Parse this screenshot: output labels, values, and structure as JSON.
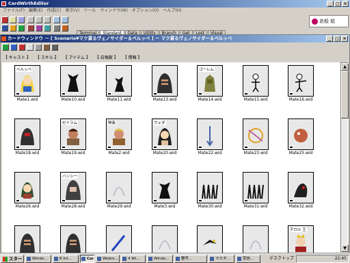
{
  "app": {
    "title": "CardWirthEditor",
    "menu": [
      "ファイル(F)",
      "編集(E)",
      "作成(C)",
      "表示(V)",
      "ツール",
      "ウィンドウ(W)",
      "オプション(O)",
      "ヘルプ(H)"
    ]
  },
  "palette": {
    "tabs": [
      "Terminal",
      "Standard",
      "Data",
      "Utility",
      "Branch",
      "Get",
      "Lost",
      "Visual"
    ],
    "active_tab": "Standard"
  },
  "logo": {
    "text": "あ般 蛤"
  },
  "cardwindow": {
    "title": "カードウィンドウ － [ Scenario¥マク貸るヴェノサイダー＆ベルッペ ] － マク貸るヴェノサイダー＆ベルッペ",
    "tabs": [
      "【 キャスト 】",
      "【 スキル 】",
      "【 アイテム 】",
      "【 召喚獣 】",
      "【 情報 】"
    ]
  },
  "cards": [
    {
      "name": "ベルッペ",
      "file": "Mate1.wid",
      "art": "girl"
    },
    {
      "name": "",
      "file": "Mate10.wid",
      "art": "beast"
    },
    {
      "name": "",
      "file": "Mate11.wid",
      "art": "imp"
    },
    {
      "name": "",
      "file": "Mate13.wid",
      "art": "hooded"
    },
    {
      "name": "ゴーレム",
      "file": "Mate14.wid",
      "art": "golem"
    },
    {
      "name": "",
      "file": "Mate15.wid",
      "art": "skeleton"
    },
    {
      "name": "",
      "file": "Mate16.wid",
      "art": "skeleton2"
    },
    {
      "name": "",
      "file": "Mate18.wid",
      "art": "knight"
    },
    {
      "name": "ゼイラム",
      "file": "Mate19.wid",
      "art": "man"
    },
    {
      "name": "隊長",
      "file": "Mate2.wid",
      "art": "man2"
    },
    {
      "name": "ウェダ",
      "file": "Mate20.wid",
      "art": "girl2"
    },
    {
      "name": "",
      "file": "Mate22.wid",
      "art": "arrow"
    },
    {
      "name": "",
      "file": "Mate23.wid",
      "art": "swirl"
    },
    {
      "name": "",
      "file": "Mate25.wid",
      "art": "blob"
    },
    {
      "name": "",
      "file": "Mate26.wid",
      "art": "girl3"
    },
    {
      "name": "バンシー",
      "file": "Mate28.wid",
      "art": "hooded2"
    },
    {
      "name": "",
      "file": "Mate29.wid",
      "art": "faded"
    },
    {
      "name": "",
      "file": "Mate3.wid",
      "art": "goblin"
    },
    {
      "name": "",
      "file": "Mate30.wid",
      "art": "army"
    },
    {
      "name": "",
      "file": "Mate31.wid",
      "art": "army"
    },
    {
      "name": "",
      "file": "Mate32.wid",
      "art": "beast2"
    },
    {
      "name": "",
      "file": "",
      "art": "hooded"
    },
    {
      "name": "",
      "file": "",
      "art": "hooded"
    },
    {
      "name": "",
      "file": "",
      "art": "sword"
    },
    {
      "name": "",
      "file": "",
      "art": "faded"
    },
    {
      "name": "",
      "file": "",
      "art": "bird"
    },
    {
      "name": "",
      "file": "",
      "art": "faded"
    },
    {
      "name": "チロル 王",
      "file": "",
      "art": "king"
    }
  ],
  "taskbar": {
    "start": "スタート",
    "buttons": [
      {
        "label": "Windo...",
        "active": false
      },
      {
        "label": "8 Int...",
        "active": false
      },
      {
        "label": "Card...",
        "active": true
      },
      {
        "label": "Webro...",
        "active": false
      },
      {
        "label": "4 Wi...",
        "active": false
      },
      {
        "label": "Windo...",
        "active": false
      },
      {
        "label": "謄写...",
        "active": false
      },
      {
        "label": "マスタ...",
        "active": false
      },
      {
        "label": "受信...",
        "active": false
      }
    ],
    "desktop": "デスクトップ",
    "clock": "22:45"
  }
}
